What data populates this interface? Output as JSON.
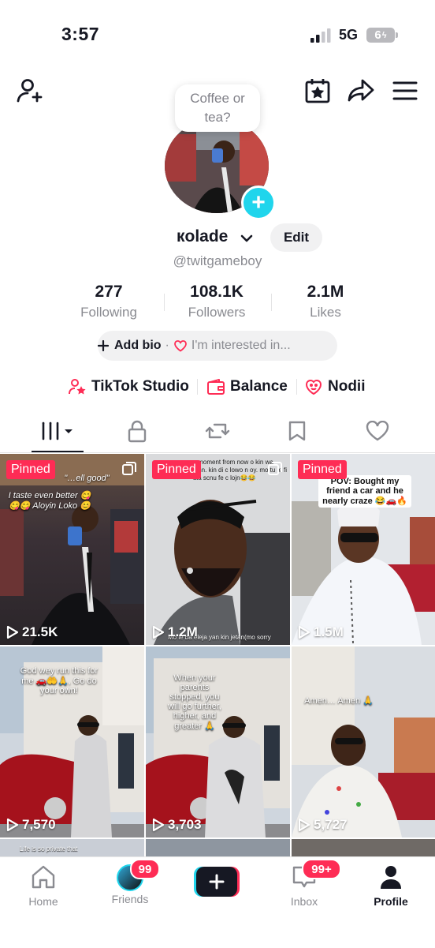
{
  "status": {
    "time": "3:57",
    "network": "5G",
    "battery": "6"
  },
  "header": {
    "bubble_text": "Coffee or tea?"
  },
  "profile": {
    "name": "кolade",
    "edit_label": "Edit",
    "handle": "@twitgameboy",
    "stats": [
      {
        "value": "277",
        "label": "Following"
      },
      {
        "value": "108.1K",
        "label": "Followers"
      },
      {
        "value": "2.1M",
        "label": "Likes"
      }
    ],
    "add_bio": "Add bio",
    "interested": "I'm interested in..."
  },
  "links": [
    {
      "label": "TikTok Studio",
      "icon": "person-star-icon"
    },
    {
      "label": "Balance",
      "icon": "wallet-icon"
    },
    {
      "label": "Nodii",
      "icon": "smiley-heart-icon"
    }
  ],
  "tabs": [
    "videos-icon",
    "lock-icon",
    "repost-icon",
    "bookmark-icon",
    "heart-icon"
  ],
  "grid": [
    {
      "views": "21.5K",
      "pinned": "Pinned",
      "caption": "I taste even better 😋😋😋 Aloyin Loko 😊",
      "top_caption": "\"…ell good\""
    },
    {
      "views": "1.2M",
      "pinned": "Pinned",
      "caption": "Mo le ba eleja yan kin jetan(mo sorry",
      "top_caption": "y moment from now o kin wa jenn. kin di c lowo n oy. mo tu le fi ala scnu fe c lojn😂😂"
    },
    {
      "views": "1.5M",
      "pinned": "Pinned",
      "caption": "POV: Bought my friend a car and he nearly craze 😂🚗🔥"
    },
    {
      "views": "7,570",
      "caption": "God wey run this for me 🚗🤲🙏, Go do your own!"
    },
    {
      "views": "3,703",
      "caption": "When your parents stopped, you will go further, higher, and greater 🙏"
    },
    {
      "views": "5,727",
      "caption": "Amen… Amen 🙏"
    }
  ],
  "peek_caption": "Life is so private that",
  "nav": {
    "home": "Home",
    "friends": "Friends",
    "friends_badge": "99",
    "inbox": "Inbox",
    "inbox_badge": "99+",
    "profile": "Profile"
  },
  "colors": {
    "accent": "#fe2c55",
    "cyan": "#20d5ec"
  }
}
